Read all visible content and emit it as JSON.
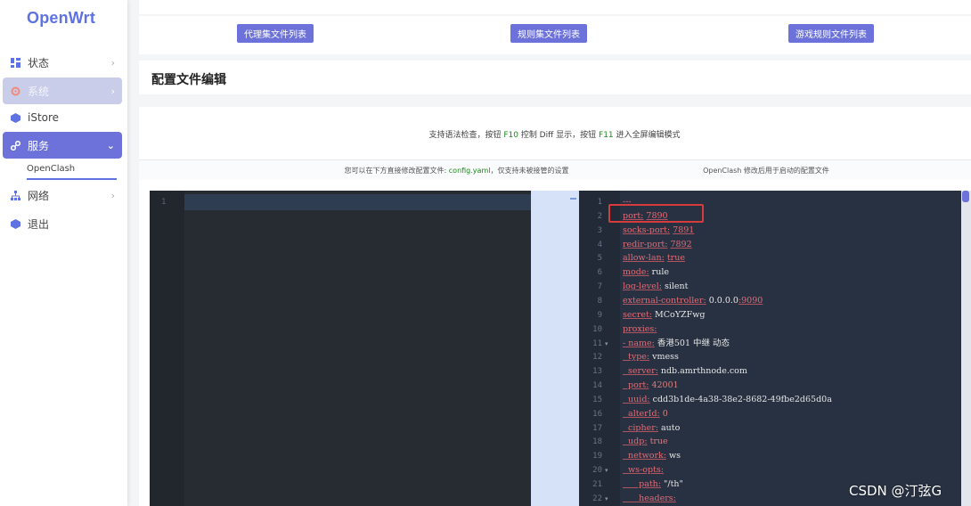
{
  "app": {
    "logo": "OpenWrt"
  },
  "sidebar": {
    "items": [
      {
        "label": "状态",
        "icon": "dashboard-icon",
        "chevron": "›"
      },
      {
        "label": "系统",
        "icon": "gear-icon",
        "chevron": "›"
      },
      {
        "label": "iStore",
        "icon": "cube-icon",
        "chevron": ""
      },
      {
        "label": "服务",
        "icon": "link-icon",
        "chevron": "⌄"
      },
      {
        "label": "网络",
        "icon": "network-icon",
        "chevron": "›"
      },
      {
        "label": "退出",
        "icon": "logout-icon",
        "chevron": ""
      }
    ],
    "subitem": "OpenClash"
  },
  "toolbar": {
    "buttons": [
      "代理集文件列表",
      "规则集文件列表",
      "游戏规则文件列表"
    ]
  },
  "section": {
    "title": "配置文件编辑",
    "hint_a": "支持语法检查，按钮 ",
    "hint_key1": "F10",
    "hint_b": " 控制 Diff 显示，按钮 ",
    "hint_key2": "F11",
    "hint_c": " 进入全屏编辑模式",
    "left_label_a": "您可以在下方直接修改配置文件: ",
    "left_label_file": "config.yaml",
    "left_label_b": "，仅支持未被接管的设置",
    "right_label": "OpenClash 修改后用于启动的配置文件"
  },
  "editor_left": {
    "line_number": "1"
  },
  "editor_right": {
    "lines": [
      {
        "n": "1",
        "fold": "",
        "parts": [
          [
            "k",
            "---"
          ]
        ]
      },
      {
        "n": "2",
        "fold": "",
        "parts": [
          [
            "k",
            "port:"
          ],
          [
            "v",
            " "
          ],
          [
            "vu",
            "7890"
          ]
        ]
      },
      {
        "n": "3",
        "fold": "",
        "parts": [
          [
            "k",
            "socks-port:"
          ],
          [
            "v",
            " "
          ],
          [
            "vu",
            "7891"
          ]
        ]
      },
      {
        "n": "4",
        "fold": "",
        "parts": [
          [
            "k",
            "redir-port:"
          ],
          [
            "v",
            " "
          ],
          [
            "vu",
            "7892"
          ]
        ]
      },
      {
        "n": "5",
        "fold": "",
        "parts": [
          [
            "k",
            "allow-lan:"
          ],
          [
            "v",
            " "
          ],
          [
            "vu",
            "true"
          ]
        ]
      },
      {
        "n": "6",
        "fold": "",
        "parts": [
          [
            "k",
            "mode:"
          ],
          [
            "v",
            " rule"
          ]
        ]
      },
      {
        "n": "7",
        "fold": "",
        "parts": [
          [
            "k",
            "log-level:"
          ],
          [
            "v",
            " silent"
          ]
        ]
      },
      {
        "n": "8",
        "fold": "",
        "parts": [
          [
            "k",
            "external-controller:"
          ],
          [
            "v",
            " 0.0.0.0"
          ],
          [
            "vu",
            ":9090"
          ]
        ]
      },
      {
        "n": "9",
        "fold": "",
        "parts": [
          [
            "k",
            "secret:"
          ],
          [
            "v",
            " MCoYZFwg"
          ]
        ]
      },
      {
        "n": "10",
        "fold": "",
        "parts": [
          [
            "k",
            "proxies:"
          ]
        ]
      },
      {
        "n": "11",
        "fold": "▾",
        "parts": [
          [
            "k",
            "- name:"
          ],
          [
            "v",
            " 香港501 中继 动态"
          ]
        ]
      },
      {
        "n": "12",
        "fold": "",
        "parts": [
          [
            "k",
            "  type:"
          ],
          [
            "v",
            " vmess"
          ]
        ]
      },
      {
        "n": "13",
        "fold": "",
        "parts": [
          [
            "k",
            "  server:"
          ],
          [
            "v",
            " ndb.amrthnode.com"
          ]
        ]
      },
      {
        "n": "14",
        "fold": "",
        "parts": [
          [
            "k",
            "  port:"
          ],
          [
            "v",
            " "
          ],
          [
            "vn",
            "42001"
          ]
        ]
      },
      {
        "n": "15",
        "fold": "",
        "parts": [
          [
            "k",
            "  uuid:"
          ],
          [
            "v",
            " cdd3b1de-4a38-38e2-8682-49fbe2d65d0a"
          ]
        ]
      },
      {
        "n": "16",
        "fold": "",
        "parts": [
          [
            "k",
            "  alterId:"
          ],
          [
            "v",
            " "
          ],
          [
            "vn",
            "0"
          ]
        ]
      },
      {
        "n": "17",
        "fold": "",
        "parts": [
          [
            "k",
            "  cipher:"
          ],
          [
            "v",
            " auto"
          ]
        ]
      },
      {
        "n": "18",
        "fold": "",
        "parts": [
          [
            "k",
            "  udp:"
          ],
          [
            "v",
            " "
          ],
          [
            "vn",
            "true"
          ]
        ]
      },
      {
        "n": "19",
        "fold": "",
        "parts": [
          [
            "k",
            "  network:"
          ],
          [
            "v",
            " ws"
          ]
        ]
      },
      {
        "n": "20",
        "fold": "▾",
        "parts": [
          [
            "k",
            "  ws-opts:"
          ]
        ]
      },
      {
        "n": "21",
        "fold": "",
        "parts": [
          [
            "k",
            "      path:"
          ],
          [
            "v",
            " \"/th\""
          ]
        ]
      },
      {
        "n": "22",
        "fold": "▾",
        "parts": [
          [
            "k",
            "      headers:"
          ]
        ]
      }
    ]
  },
  "watermark": "CSDN @汀弦G"
}
